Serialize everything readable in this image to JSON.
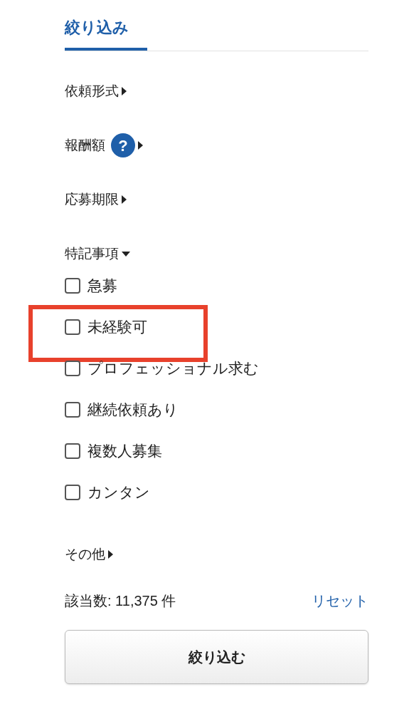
{
  "header": {
    "label": "絞り込み",
    "selected": true
  },
  "sections": [
    {
      "label": "依頼形式",
      "expanded": false
    },
    {
      "label": "報酬額",
      "expanded": false,
      "help": "?"
    },
    {
      "label": "応募期限",
      "expanded": false
    },
    {
      "label": "特記事項",
      "expanded": true,
      "options": [
        {
          "label": "急募",
          "checked": false,
          "highlighted": false
        },
        {
          "label": "未経験可",
          "checked": false,
          "highlighted": true
        },
        {
          "label": "プロフェッショナル求む",
          "checked": false,
          "highlighted": false
        },
        {
          "label": "継続依頼あり",
          "checked": false,
          "highlighted": false
        },
        {
          "label": "複数人募集",
          "checked": false,
          "highlighted": false
        },
        {
          "label": "カンタン",
          "checked": false,
          "highlighted": false
        }
      ]
    },
    {
      "label": "その他",
      "expanded": false
    }
  ],
  "footer": {
    "count": "該当数: 11,375 件",
    "reset": "リセット",
    "submit": "絞り込む"
  }
}
